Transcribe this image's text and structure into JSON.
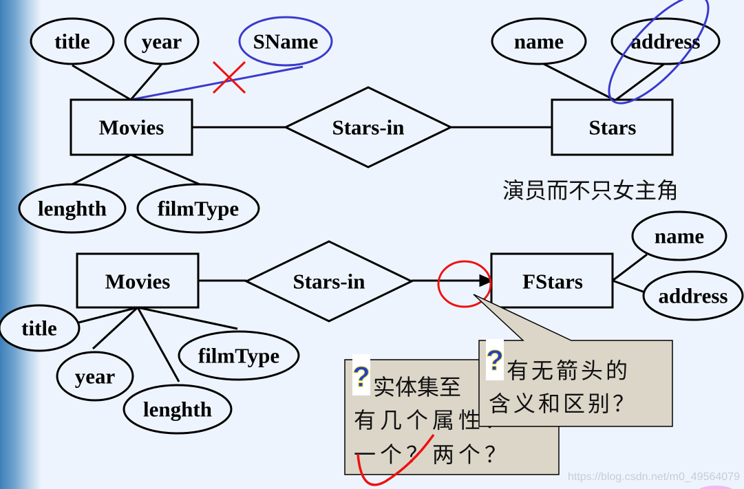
{
  "top_diagram": {
    "entity_left": "Movies",
    "relationship": "Stars-in",
    "entity_right": "Stars",
    "attrs_left": [
      "title",
      "year",
      "SName",
      "lenghth",
      "filmType"
    ],
    "attrs_right": [
      "name",
      "address"
    ],
    "note": "演员而不只女主角"
  },
  "bottom_diagram": {
    "entity_left": "Movies",
    "relationship": "Stars-in",
    "entity_right": "FStars",
    "attrs_left": [
      "title",
      "year",
      "lenghth",
      "filmType"
    ],
    "attrs_right": [
      "name",
      "address"
    ]
  },
  "callouts": [
    {
      "icon": "question-icon",
      "lines": [
        "实体集至",
        "有几个属性？",
        "一个？两个？"
      ]
    },
    {
      "icon": "question-icon",
      "lines": [
        "有无箭头的",
        "含义和区别？"
      ]
    }
  ],
  "watermark": "https://blog.csdn.net/m0_49564079",
  "colors": {
    "annotation_blue": "#3a3acc",
    "annotation_red": "#ee1111",
    "callout_bg": "#dcd6c9"
  }
}
